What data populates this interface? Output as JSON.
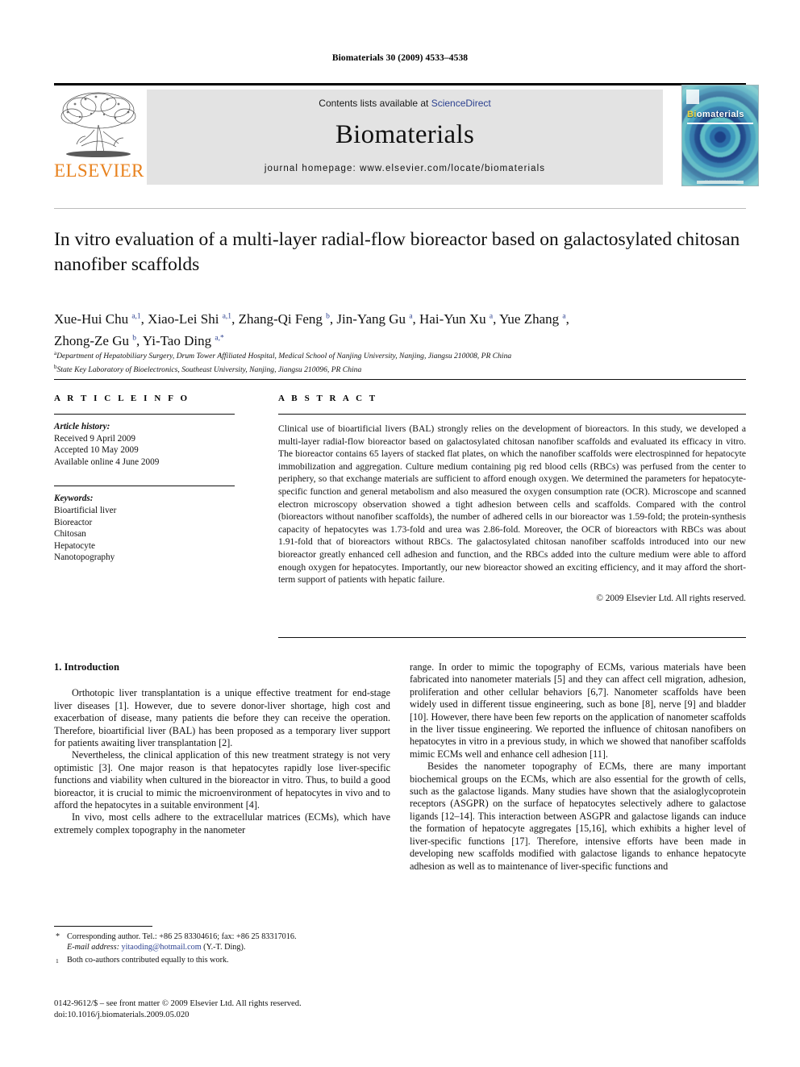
{
  "running_head": "Biomaterials 30 (2009) 4533–4538",
  "masthead": {
    "publisher": "ELSEVIER",
    "contents_prefix": "Contents lists available at ",
    "contents_link": "ScienceDirect",
    "journal_name": "Biomaterials",
    "homepage": "journal homepage: www.elsevier.com/locate/biomaterials",
    "cover": {
      "title_first": "Bi",
      "title_rest": "omaterials",
      "footer_text": "An international journal"
    }
  },
  "article": {
    "title": "In vitro evaluation of a multi-layer radial-flow bioreactor based on galactosylated chitosan nanofiber scaffolds",
    "authors_line_1": "Xue-Hui Chu a,1, Xiao-Lei Shi a,1, Zhang-Qi Feng b, Jin-Yang Gu a, Hai-Yun Xu a, Yue Zhang a,",
    "authors_line_2": "Zhong-Ze Gu b, Yi-Tao Ding a,*",
    "affiliation_a": "Department of Hepatobiliary Surgery, Drum Tower Affiliated Hospital, Medical School of Nanjing University, Nanjing, Jiangsu 210008, PR China",
    "affiliation_b": "State Key Laboratory of Bioelectronics, Southeast University, Nanjing, Jiangsu 210096, PR China"
  },
  "article_info": {
    "heading": "A R T I C L E   I N F O",
    "history_label": "Article history:",
    "history": [
      "Received 9 April 2009",
      "Accepted 10 May 2009",
      "Available online 4 June 2009"
    ],
    "keywords_label": "Keywords:",
    "keywords": [
      "Bioartificial liver",
      "Bioreactor",
      "Chitosan",
      "Hepatocyte",
      "Nanotopography"
    ]
  },
  "abstract": {
    "heading": "A B S T R A C T",
    "text": "Clinical use of bioartificial livers (BAL) strongly relies on the development of bioreactors. In this study, we developed a multi-layer radial-flow bioreactor based on galactosylated chitosan nanofiber scaffolds and evaluated its efficacy in vitro. The bioreactor contains 65 layers of stacked flat plates, on which the nanofiber scaffolds were electrospinned for hepatocyte immobilization and aggregation. Culture medium containing pig red blood cells (RBCs) was perfused from the center to periphery, so that exchange materials are sufficient to afford enough oxygen. We determined the parameters for hepatocyte-specific function and general metabolism and also measured the oxygen consumption rate (OCR). Microscope and scanned electron microscopy observation showed a tight adhesion between cells and scaffolds. Compared with the control (bioreactors without nanofiber scaffolds), the number of adhered cells in our bioreactor was 1.59-fold; the protein-synthesis capacity of hepatocytes was 1.73-fold and urea was 2.86-fold. Moreover, the OCR of bioreactors with RBCs was about 1.91-fold that of bioreactors without RBCs. The galactosylated chitosan nanofiber scaffolds introduced into our new bioreactor greatly enhanced cell adhesion and function, and the RBCs added into the culture medium were able to afford enough oxygen for hepatocytes. Importantly, our new bioreactor showed an exciting efficiency, and it may afford the short-term support of patients with hepatic failure.",
    "copyright": "© 2009 Elsevier Ltd. All rights reserved."
  },
  "body": {
    "section_heading": "1.  Introduction",
    "left_paragraphs": [
      "Orthotopic liver transplantation is a unique effective treatment for end-stage liver diseases [1]. However, due to severe donor-liver shortage, high cost and exacerbation of disease, many patients die before they can receive the operation. Therefore, bioartificial liver (BAL) has been proposed as a temporary liver support for patients awaiting liver transplantation [2].",
      "Nevertheless, the clinical application of this new treatment strategy is not very optimistic [3]. One major reason is that hepatocytes rapidly lose liver-specific functions and viability when cultured in the bioreactor in vitro. Thus, to build a good bioreactor, it is crucial to mimic the microenvironment of hepatocytes in vivo and to afford the hepatocytes in a suitable environment [4].",
      "In vivo, most cells adhere to the extracellular matrices (ECMs), which have extremely complex topography in the nanometer"
    ],
    "right_paragraphs": [
      "range. In order to mimic the topography of ECMs, various materials have been fabricated into nanometer materials [5] and they can affect cell migration, adhesion, proliferation and other cellular behaviors [6,7]. Nanometer scaffolds have been widely used in different tissue engineering, such as bone [8], nerve [9] and bladder [10]. However, there have been few reports on the application of nanometer scaffolds in the liver tissue engineering. We reported the influence of chitosan nanofibers on hepatocytes in vitro in a previous study, in which we showed that nanofiber scaffolds mimic ECMs well and enhance cell adhesion [11].",
      "Besides the nanometer topography of ECMs, there are many important biochemical groups on the ECMs, which are also essential for the growth of cells, such as the galactose ligands. Many studies have shown that the asialoglycoprotein receptors (ASGPR) on the surface of hepatocytes selectively adhere to galactose ligands [12–14]. This interaction between ASGPR and galactose ligands can induce the formation of hepatocyte aggregates [15,16], which exhibits a higher level of liver-specific functions [17]. Therefore, intensive efforts have been made in developing new scaffolds modified with galactose ligands to enhance hepatocyte adhesion as well as to maintenance of liver-specific functions and"
    ]
  },
  "footnotes": {
    "corresponding_marker": "*",
    "corresponding": "Corresponding author. Tel.: +86 25 83304616; fax: +86 25 83317016.",
    "email_label": "E-mail address:",
    "email": "yitaoding@hotmail.com",
    "email_suffix": "(Y.-T. Ding).",
    "equal_marker": "1",
    "equal_contribution": "Both co-authors contributed equally to this work."
  },
  "colophon": {
    "line1": "0142-9612/$ – see front matter © 2009 Elsevier Ltd. All rights reserved.",
    "line2": "doi:10.1016/j.biomaterials.2009.05.020"
  }
}
